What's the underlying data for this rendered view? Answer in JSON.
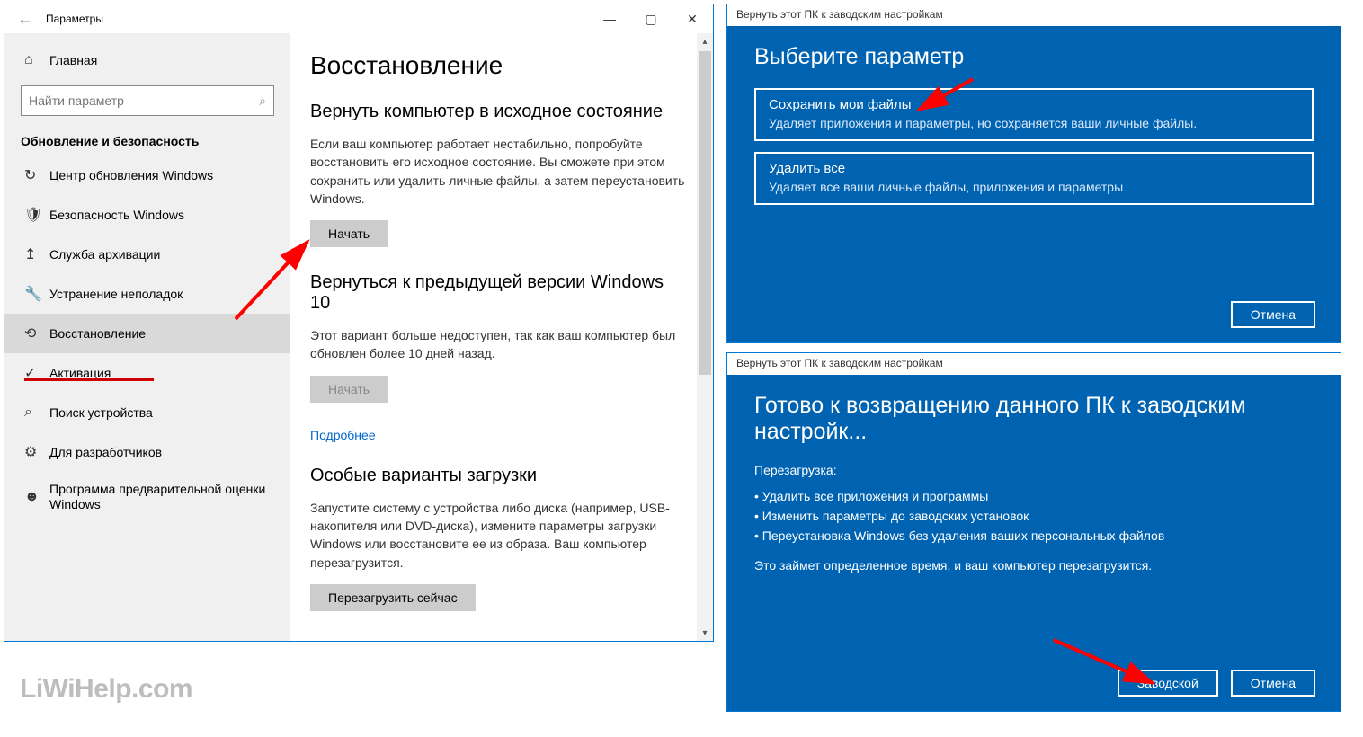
{
  "settings": {
    "window_title": "Параметры",
    "home": "Главная",
    "search_placeholder": "Найти параметр",
    "category": "Обновление и безопасность",
    "nav": [
      {
        "icon": "↻",
        "label": "Центр обновления Windows"
      },
      {
        "icon": "🛡",
        "label": "Безопасность Windows"
      },
      {
        "icon": "↥",
        "label": "Служба архивации"
      },
      {
        "icon": "🔧",
        "label": "Устранение неполадок"
      },
      {
        "icon": "⟲",
        "label": "Восстановление",
        "active": true
      },
      {
        "icon": "✓",
        "label": "Активация"
      },
      {
        "icon": "⌕",
        "label": "Поиск устройства"
      },
      {
        "icon": "⚙",
        "label": "Для разработчиков"
      },
      {
        "icon": "☻",
        "label": "Программа предварительной оценки Windows"
      }
    ],
    "page_title": "Восстановление",
    "reset": {
      "heading": "Вернуть компьютер в исходное состояние",
      "desc": "Если ваш компьютер работает нестабильно, попробуйте восстановить его исходное состояние. Вы сможете при этом сохранить или удалить личные файлы, а затем переустановить Windows.",
      "button": "Начать"
    },
    "rollback": {
      "heading": "Вернуться к предыдущей версии Windows 10",
      "desc": "Этот вариант больше недоступен, так как ваш компьютер был обновлен более 10 дней назад.",
      "button": "Начать",
      "link": "Подробнее"
    },
    "advanced": {
      "heading": "Особые варианты загрузки",
      "desc": "Запустите систему с устройства либо диска (например, USB-накопителя или DVD-диска), измените параметры загрузки Windows или восстановите ее из образа. Ваш компьютер перезагрузится.",
      "button": "Перезагрузить сейчас"
    }
  },
  "dialog1": {
    "title": "Вернуть этот ПК к заводским настройкам",
    "heading": "Выберите параметр",
    "options": [
      {
        "title": "Сохранить мои файлы",
        "desc": "Удаляет приложения и параметры, но сохраняется ваши личные файлы."
      },
      {
        "title": "Удалить все",
        "desc": "Удаляет все ваши личные файлы, приложения и параметры"
      }
    ],
    "cancel": "Отмена"
  },
  "dialog2": {
    "title": "Вернуть этот ПК к заводским настройкам",
    "heading": "Готово к возвращению данного ПК к заводским настройк...",
    "reboot_label": "Перезагрузка:",
    "bullets": [
      "Удалить все приложения и программы",
      "Изменить параметры до заводских установок",
      "Переустановка Windows без удаления ваших персональных файлов"
    ],
    "note": "Это займет определенное время, и ваш компьютер перезагрузится.",
    "confirm": "Заводской",
    "cancel": "Отмена"
  },
  "watermark": "LiWiHelp.com"
}
